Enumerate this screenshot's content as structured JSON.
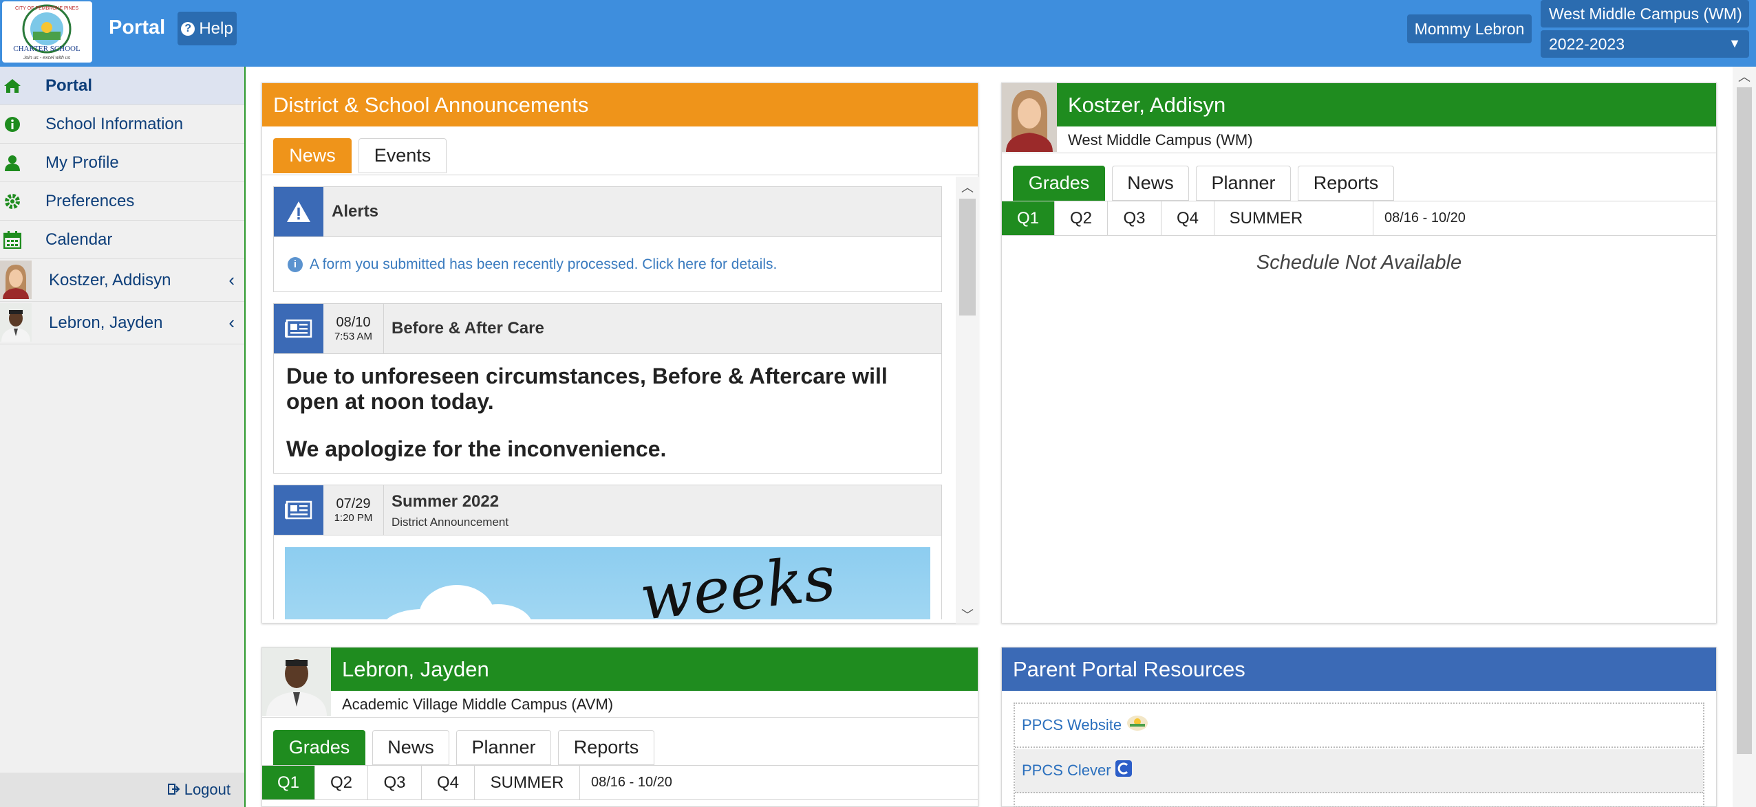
{
  "header": {
    "app_title": "Portal",
    "help_label": "Help",
    "user_name": "Mommy Lebron",
    "campus": "West Middle Campus (WM)",
    "school_year": "2022-2023"
  },
  "logo": {
    "text_top": "CITY OF PEMBROKE PINES",
    "text_mid": "CHARTER SCHOOL",
    "text_bottom": "Join us - excel with us"
  },
  "sidebar": {
    "items": [
      {
        "label": "Portal",
        "icon": "home-icon"
      },
      {
        "label": "School Information",
        "icon": "info-circle-icon"
      },
      {
        "label": "My Profile",
        "icon": "user-icon"
      },
      {
        "label": "Preferences",
        "icon": "gear-icon"
      },
      {
        "label": "Calendar",
        "icon": "calendar-icon"
      }
    ],
    "students": [
      {
        "label": "Kostzer, Addisyn"
      },
      {
        "label": "Lebron, Jayden"
      }
    ],
    "logout_label": "Logout"
  },
  "announcements": {
    "title": "District & School Announcements",
    "tabs": [
      "News",
      "Events"
    ],
    "alert": {
      "title": "Alerts",
      "message": "A form you submitted has been recently processed. Click here for details."
    },
    "posts": [
      {
        "date": "08/10",
        "time": "7:53 AM",
        "title": "Before & After Care",
        "body_1": "Due to unforeseen circumstances, Before & Aftercare will open at noon today.",
        "body_2": "We apologize for the inconvenience."
      },
      {
        "date": "07/29",
        "time": "1:20 PM",
        "title": "Summer 2022",
        "subtitle": "District Announcement",
        "image_text": "weeks"
      }
    ]
  },
  "students": [
    {
      "name": "Kostzer, Addisyn",
      "campus": "West Middle Campus (WM)",
      "tabs": [
        "Grades",
        "News",
        "Planner",
        "Reports"
      ],
      "quarters": [
        "Q1",
        "Q2",
        "Q3",
        "Q4",
        "SUMMER"
      ],
      "date_range": "08/16 - 10/20",
      "schedule_message": "Schedule Not Available"
    },
    {
      "name": "Lebron, Jayden",
      "campus": "Academic Village Middle Campus (AVM)",
      "tabs": [
        "Grades",
        "News",
        "Planner",
        "Reports"
      ],
      "quarters": [
        "Q1",
        "Q2",
        "Q3",
        "Q4",
        "SUMMER"
      ],
      "date_range": "08/16 - 10/20"
    }
  ],
  "resources": {
    "title": "Parent Portal Resources",
    "links": [
      {
        "label": "PPCS Website",
        "icon": "ppcs-logo-icon"
      },
      {
        "label": "PPCS Clever",
        "icon": "clever-icon"
      }
    ]
  },
  "colors": {
    "topbar": "#3e8edd",
    "announcement_header": "#ef941a",
    "student_header": "#1f8c1f",
    "resources_header": "#3b6ab6"
  }
}
